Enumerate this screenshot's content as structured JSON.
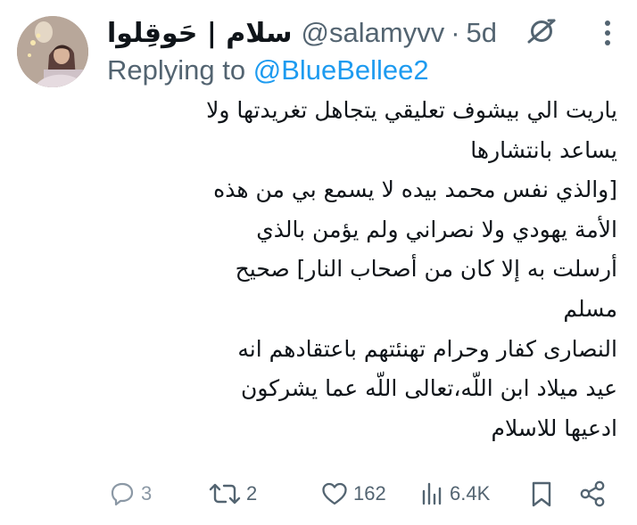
{
  "author": {
    "display_name": "سلام | حَوقِلوا",
    "handle": "@salamyvv",
    "separator": "·",
    "age": "5d"
  },
  "reply_context": {
    "prefix": "Replying to",
    "mention": "@BlueBellee2"
  },
  "body": {
    "lines": [
      "ياريت الي بيشوف تعليقي يتجاهل تغريدتها ولا",
      "يساعد بانتشارها",
      "[والذي نفس محمد بيده لا يسمع بي من هذه",
      "الأمة يهودي ولا نصراني ولم يؤمن بالذي",
      "أرسلت به إلا كان من أصحاب النار] صحيح",
      "مسلم",
      "النصارى كفار وحرام تهنئتهم باعتقادهم انه",
      "عيد ميلاد ابن اللّه،تعالى اللّه عما يشركون",
      "ادعيها للاسلام"
    ]
  },
  "actions": {
    "replies": "3",
    "reposts": "2",
    "likes": "162",
    "views": "6.4K"
  },
  "icons": {
    "avatar": "profile-photo",
    "grok": "grok-icon",
    "more": "more-icon",
    "reply": "reply-icon",
    "repost": "repost-icon",
    "like": "heart-icon",
    "views": "views-chart-icon",
    "bookmark": "bookmark-icon",
    "share": "share-icon"
  },
  "colors": {
    "text_primary": "#0f1419",
    "text_secondary": "#536471",
    "link": "#1d9bf0",
    "background": "#ffffff"
  }
}
